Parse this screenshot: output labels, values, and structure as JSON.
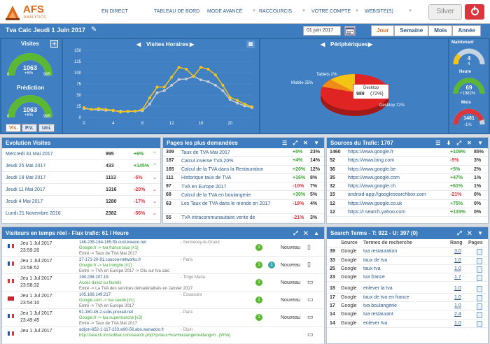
{
  "nav": {
    "brand": "AFS",
    "brand_sub": "ANALYTICS",
    "items": [
      {
        "label": "EN DIRECT"
      },
      {
        "label": "TABLEAU DE BORD"
      },
      {
        "label": "MODE AVANCÉ"
      },
      {
        "label": "RACCOURCIS"
      },
      {
        "label": "VOTRE COMPTE"
      },
      {
        "label": "WEBSITE(S)"
      }
    ],
    "silver": "Silver"
  },
  "header": {
    "title": "Tva Calc Jeudi 1 Juin 2017",
    "date": "01 juin 2017",
    "tabs": [
      "Jour",
      "Semaine",
      "Mois",
      "Année"
    ],
    "active_tab": "Jour"
  },
  "visites": {
    "label": "Visites",
    "value": "1063",
    "pct": "+6%",
    "min": "0",
    "max": "995"
  },
  "prediction": {
    "label": "Prédiction",
    "value": "1063",
    "pct": "+6%",
    "min": "0",
    "max": "995"
  },
  "mode_tabs": [
    "Vis.",
    "P.V.",
    "Uni."
  ],
  "hourly": {
    "title": "Visites Horaires"
  },
  "chart_data": {
    "type": "line",
    "x": [
      0,
      1,
      2,
      3,
      4,
      5,
      6,
      7,
      8,
      9,
      10,
      11,
      12,
      13,
      14,
      15,
      16,
      17,
      18,
      19,
      20,
      21,
      22,
      23
    ],
    "series": [
      {
        "values": [
          22,
          18,
          20,
          18,
          16,
          12,
          14,
          14,
          18,
          44,
          68,
          68,
          90,
          112,
          108,
          92,
          112,
          108,
          95,
          72,
          45,
          38,
          30,
          24
        ]
      },
      {
        "values": [
          20,
          18,
          17,
          16,
          15,
          14,
          13,
          14,
          15,
          30,
          55,
          60,
          72,
          85,
          86,
          92,
          84,
          80,
          72,
          60,
          40,
          32,
          26,
          22
        ]
      }
    ],
    "ylim": [
      0,
      150
    ],
    "yticks": [
      0,
      25,
      50,
      75,
      100,
      125,
      150
    ],
    "xticks": [
      0,
      4,
      8,
      12,
      16,
      20
    ]
  },
  "devices": {
    "title": "Périphériques",
    "tablets": "Tablets 2%",
    "mobile": "Mobile 25%",
    "desktop": "Desktop 72%",
    "tooltip_label": "Desktop",
    "tooltip_value": "989",
    "tooltip_pct": "(72%)"
  },
  "right_gauges": {
    "now": {
      "label": "Maintenant",
      "value": "4",
      "sub": "4"
    },
    "hour": {
      "label": "Heure",
      "value": "69",
      "sub": "+1982%"
    },
    "month": {
      "label": "Mois",
      "value": "1481",
      "sub": "-1%"
    }
  },
  "evolution": {
    "title": "Evolution Visites",
    "rows": [
      {
        "date": "Mercredi 31 Mai 2017",
        "val": "995",
        "pct": "+6%",
        "up": true
      },
      {
        "date": "Jeudi 25 Mai 2017",
        "val": "433",
        "pct": "+145%",
        "up": true
      },
      {
        "date": "Jeudi 18 Mai 2017",
        "val": "1113",
        "pct": "-5%",
        "up": false
      },
      {
        "date": "Jeudi 11 Mai 2017",
        "val": "1316",
        "pct": "-20%",
        "up": false
      },
      {
        "date": "Jeudi 4 Mai 2017",
        "val": "1280",
        "pct": "-17%",
        "up": false
      },
      {
        "date": "Lundi 21 Novembre 2016",
        "val": "2382",
        "pct": "-56%",
        "up": false
      }
    ]
  },
  "pages": {
    "title": "Pages les plus demandées",
    "rows": [
      {
        "n": "309",
        "label": "Taux de TVA Mai 2017",
        "pct": "+5%",
        "share": "23%"
      },
      {
        "n": "187",
        "label": "Calcul inverse TVA 20%",
        "pct": "+4%",
        "share": "14%"
      },
      {
        "n": "165",
        "label": "Calcul de la TVA dans la Restauration",
        "pct": "+20%",
        "share": "12%"
      },
      {
        "n": "111",
        "label": "Historique taux de TVA",
        "pct": "+16%",
        "share": "8%"
      },
      {
        "n": "97",
        "label": "TVA en Europe 2017",
        "pct": "-10%",
        "share": "7%"
      },
      {
        "n": "68",
        "label": "Calcul de la TVA en boulangerie",
        "pct": "+30%",
        "share": "5%"
      },
      {
        "n": "63",
        "label": "Les Taux de TVA dans le monde en 2017",
        "pct": "-19%",
        "share": "4%"
      },
      {
        "n": "55",
        "label": "TVA intracommunautaire vente de",
        "pct": "-21%",
        "share": "3%"
      }
    ]
  },
  "sources": {
    "title": "Sources du Trafic: 1707",
    "rows": [
      {
        "n": "1460",
        "url": "https://www.google.fr",
        "pct": "+109%",
        "share": "85%"
      },
      {
        "n": "52",
        "url": "https://www.bing.com",
        "pct": "-5%",
        "share": "3%"
      },
      {
        "n": "36",
        "url": "https://www.google.be",
        "pct": "+5%",
        "share": "2%"
      },
      {
        "n": "35",
        "url": "https://www.google.com",
        "pct": "+47%",
        "share": "1%"
      },
      {
        "n": "32",
        "url": "https://www.google.ch",
        "pct": "+61%",
        "share": "1%"
      },
      {
        "n": "15",
        "url": "android-app://googlesearchbox.com",
        "pct": "-21%",
        "share": "0%"
      },
      {
        "n": "12",
        "url": "https://www.google.co.uk",
        "pct": "+75%",
        "share": "0%"
      },
      {
        "n": "12",
        "url": "https://r.search.yahoo.com",
        "pct": "+133%",
        "share": "0%"
      }
    ]
  },
  "realtime": {
    "title": "Visiteurs en temps réel - Flux trafic: 61 / Heure",
    "rows": [
      {
        "date": "Jeu 1 Jul 2017",
        "time": "23:59:20",
        "l1": "146-235-164-185.fth.cust.kwaoo.net",
        "l1b": " - Sennecey-le-Grand",
        "l2": "Google.fr -> tva france taux [#1]",
        "l3": "Entré -> Taux de TVA Mai 2017",
        "badge": "1",
        "badge2": "",
        "nouveau": "Nouveau",
        "flag": "fr"
      },
      {
        "date": "Jeu 1 Jul 2017",
        "time": "23:58:52",
        "l1": "37-171-20-91.coucou-networks.fr",
        "l1b": " - Paris",
        "l2": "Google.fr -> tva hongrie [#1]",
        "l3": "Entré -> TVA en Europe 2017 -> Clic sur tva calc",
        "badge": "1",
        "badge2": "1",
        "nouveau": "Nouveau",
        "flag": "fr"
      },
      {
        "date": "Jeu 1 Jul 2017",
        "time": "23:58:32",
        "l1": "190.236.207.19",
        "l1b": " - Tingo Maria",
        "l2": "Accès direct ou favoris",
        "l3": "Entré -> La TVA des services dématérialisés en Janvier 2017",
        "badge": "1",
        "badge2": "",
        "nouveau": "Nouveau",
        "flag": "pe"
      },
      {
        "date": "Jeu 1 Jul 2017",
        "time": "23:54:10",
        "l1": "105.189.149.217",
        "l1b": " - Essaouira",
        "l2": "Google.com -> tva suede [#1]",
        "l3": "Entré -> TVA en Europe 2017",
        "badge": "1",
        "badge2": "",
        "nouveau": "Nouveau",
        "flag": "ma"
      },
      {
        "date": "Jeu 1 Jul 2017",
        "time": "23:49:45",
        "l1": "91-160-45-2.subs.proxad.net",
        "l1b": " - Paris",
        "l2": "Google.fr -> tva supermarché [#3]",
        "l3": "Entré -> Taux de TVA Mai 2017",
        "badge": "1",
        "badge2": "",
        "nouveau": "Nouveau",
        "flag": "fr"
      },
      {
        "date": "Jeu 1 Jul 2017",
        "time": "",
        "l1": "adijon-652-1-117-233.w90-56.abo.wanadoo.fr",
        "l1b": " - Dijon",
        "l2": "http://search.incredibar.com/search.php?q=taux+tva+boulangerie&lang=fr...[Who]",
        "l3": "",
        "badge": "",
        "badge2": "",
        "nouveau": "",
        "flag": "fr"
      }
    ]
  },
  "search": {
    "title": "Search Terms - T: 922 - U: 397 (0)",
    "headers": [
      "Source",
      "Termes de recherche",
      "Rang",
      "Pages"
    ],
    "rows": [
      {
        "n": "39",
        "src": "Google",
        "term": "tva restauration",
        "rang": "3.0"
      },
      {
        "n": "33",
        "src": "Google",
        "term": "taux de tva",
        "rang": "1.0"
      },
      {
        "n": "25",
        "src": "Google",
        "term": "taux tva",
        "rang": "1.0"
      },
      {
        "n": "23",
        "src": "Google",
        "term": "tva france",
        "rang": "1.7"
      },
      {
        "n": "18",
        "src": "Google",
        "term": "enlever la tva",
        "rang": "1.0"
      },
      {
        "n": "17",
        "src": "Google",
        "term": "taux de tva en france",
        "rang": "1.0"
      },
      {
        "n": "17",
        "src": "Google",
        "term": "tva boulangerie",
        "rang": "1.0"
      },
      {
        "n": "14",
        "src": "Google",
        "term": "tva restaurant",
        "rang": "2.4"
      },
      {
        "n": "14",
        "src": "Google",
        "term": "enlever tva",
        "rang": "1.0"
      }
    ]
  }
}
